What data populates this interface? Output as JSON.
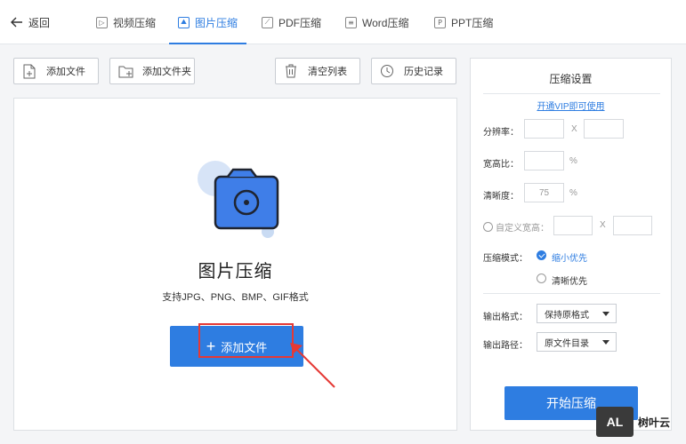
{
  "nav": {
    "back": "返回",
    "tabs": [
      {
        "label": "视频压缩",
        "icon": "video-icon"
      },
      {
        "label": "图片压缩",
        "icon": "image-icon",
        "active": true
      },
      {
        "label": "PDF压缩",
        "icon": "pdf-icon"
      },
      {
        "label": "Word压缩",
        "icon": "word-icon"
      },
      {
        "label": "PPT压缩",
        "icon": "ppt-icon"
      }
    ]
  },
  "toolbar": {
    "add_file": "添加文件",
    "add_folder": "添加文件夹",
    "clear_list": "清空列表",
    "history": "历史记录"
  },
  "main": {
    "title": "图片压缩",
    "subtitle": "支持JPG、PNG、BMP、GIF格式",
    "add_button": "添加文件",
    "add_button_icon": "plus-icon"
  },
  "settings": {
    "title": "压缩设置",
    "vip_link": "开通VIP即可使用",
    "resolution_label": "分辨率：",
    "resolution_sep": "X",
    "aspect_label": "宽高比：",
    "aspect_unit": "%",
    "clarity_label": "清晰度：",
    "clarity_value": "75",
    "clarity_unit": "%",
    "custom_size_label": "自定义宽高：",
    "custom_size_sep": "X",
    "mode_label": "压缩模式：",
    "mode_options": [
      "缩小优先",
      "清晰优先"
    ],
    "mode_selected": "缩小优先",
    "format_label": "输出格式：",
    "format_value": "保持原格式",
    "path_label": "输出路径：",
    "path_value": "原文件目录",
    "start_button": "开始压缩"
  },
  "colors": {
    "accent": "#2e7de1",
    "highlight": "#e53935"
  },
  "watermark": {
    "logo": "AL",
    "text": "树叶云"
  }
}
